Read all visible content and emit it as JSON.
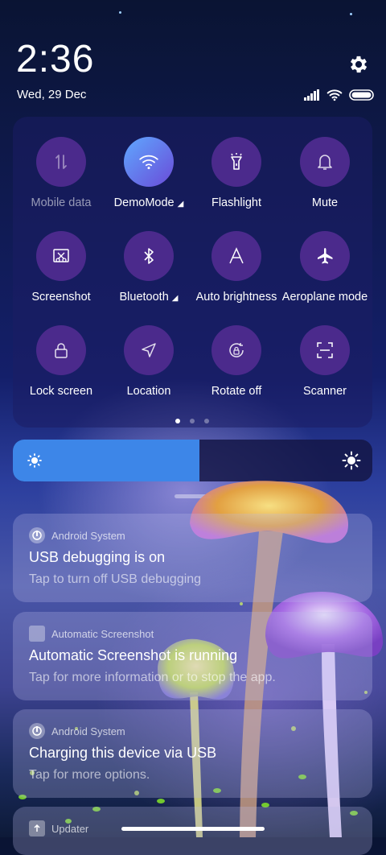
{
  "status": {
    "time": "2:36",
    "date": "Wed, 29 Dec",
    "icons": [
      "signal-icon",
      "wifi-icon",
      "battery-icon",
      "settings-icon"
    ]
  },
  "quick_settings": {
    "tiles": [
      {
        "label": "Mobile data",
        "icon": "mobile-data-icon",
        "active": false,
        "dim": true
      },
      {
        "label": "DemoMode",
        "icon": "wifi-icon",
        "active": true,
        "dim": false
      },
      {
        "label": "Flashlight",
        "icon": "flashlight-icon",
        "active": false,
        "dim": false
      },
      {
        "label": "Mute",
        "icon": "bell-icon",
        "active": false,
        "dim": false
      },
      {
        "label": "Screenshot",
        "icon": "screenshot-icon",
        "active": false,
        "dim": false
      },
      {
        "label": "Bluetooth",
        "icon": "bluetooth-icon",
        "active": false,
        "dim": false
      },
      {
        "label": "Auto brightness",
        "icon": "auto-brightness-icon",
        "active": false,
        "dim": false
      },
      {
        "label": "Aeroplane mode",
        "icon": "airplane-icon",
        "active": false,
        "dim": false
      },
      {
        "label": "Lock screen",
        "icon": "lock-icon",
        "active": false,
        "dim": false
      },
      {
        "label": "Location",
        "icon": "location-icon",
        "active": false,
        "dim": false
      },
      {
        "label": "Rotate off",
        "icon": "rotate-lock-icon",
        "active": false,
        "dim": false
      },
      {
        "label": "Scanner",
        "icon": "scanner-icon",
        "active": false,
        "dim": false
      }
    ],
    "page_indicator": {
      "pages": 3,
      "current": 1
    }
  },
  "brightness": {
    "level": 0.52
  },
  "notifications": [
    {
      "app": "Android System",
      "title": "USB debugging is on",
      "text": "Tap to turn off USB debugging",
      "icon": "android-system-icon"
    },
    {
      "app": "Automatic Screenshot",
      "title": "Automatic Screenshot is running",
      "text": "Tap for more information or to stop the app.",
      "icon": "app-icon"
    },
    {
      "app": "Android System",
      "title": "Charging this device via USB",
      "text": "Tap for more options.",
      "icon": "android-system-icon"
    },
    {
      "app": "Updater",
      "title": "",
      "text": "",
      "icon": "updater-icon"
    }
  ],
  "colors": {
    "accent": "#3d86e8",
    "tile_bg": "#4b2a8c"
  }
}
